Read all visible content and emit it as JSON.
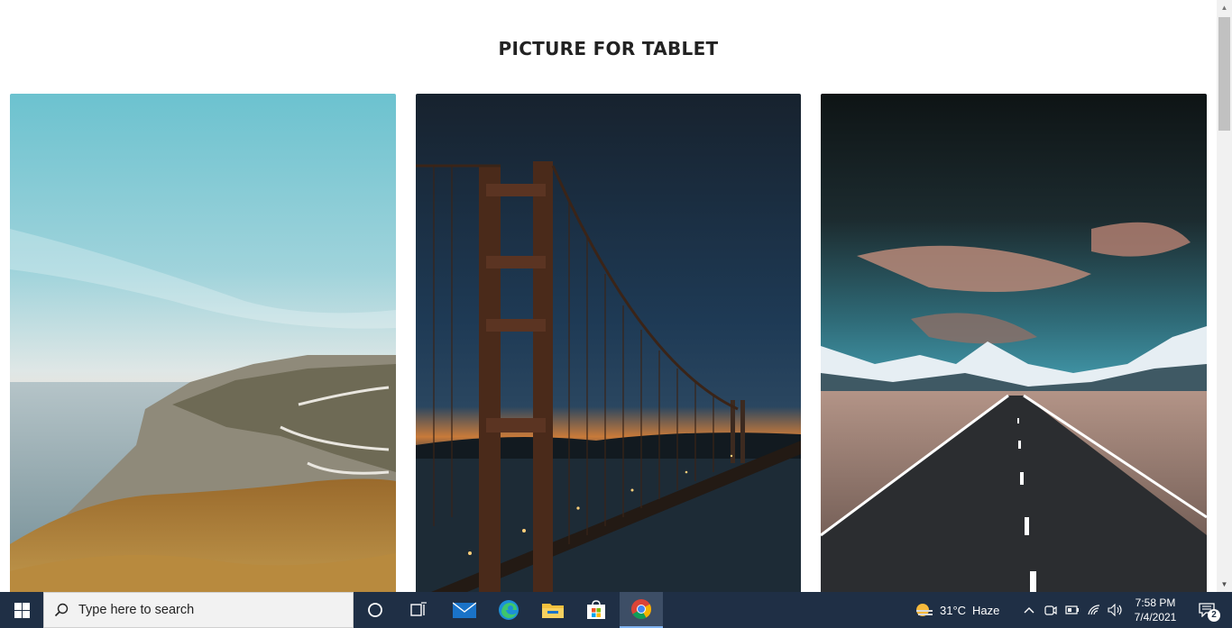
{
  "page": {
    "title": "PICTURE FOR TABLET",
    "photos": [
      {
        "alt": "coastal cliffs with winding road at sunset"
      },
      {
        "alt": "suspension bridge at dusk"
      },
      {
        "alt": "straight road toward snowy mountains"
      }
    ]
  },
  "taskbar": {
    "search_placeholder": "Type here to search",
    "weather_temp": "31°C",
    "weather_text": "Haze",
    "time": "7:58 PM",
    "date": "7/4/2021",
    "notification_count": "2",
    "icons": {
      "start": "windows-logo-icon",
      "search": "magnifier-icon",
      "cortana": "circle-icon",
      "task_view": "task-view-icon",
      "mail": "mail-icon",
      "edge": "edge-icon",
      "files": "folder-icon",
      "store": "store-icon",
      "chrome": "chrome-icon",
      "weather": "sun-haze-icon",
      "chevron": "chevron-up-icon",
      "meet": "meet-now-icon",
      "battery": "battery-icon",
      "network": "wifi-icon",
      "volume": "speaker-icon",
      "notifications": "action-center-icon"
    }
  },
  "colors": {
    "taskbar": "#1f2f45",
    "accent": "#7fb2f0"
  }
}
